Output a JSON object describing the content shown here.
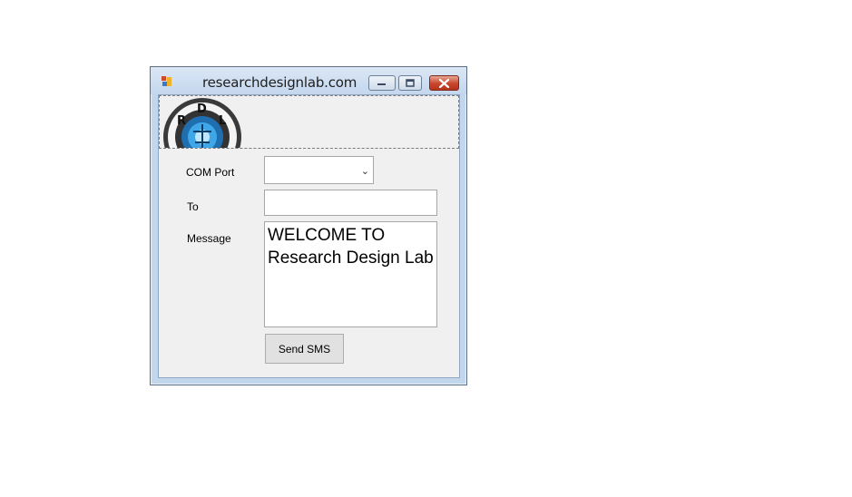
{
  "window": {
    "title": "researchdesignlab.com",
    "icon": "app-icon",
    "controls": [
      "minimize-icon",
      "maximize-icon",
      "close-icon"
    ]
  },
  "logo": {
    "letters": [
      "R",
      "D",
      "L"
    ]
  },
  "form": {
    "com_port_label": "COM Port",
    "com_port_value": "",
    "to_label": "To",
    "to_value": "",
    "message_label": "Message",
    "message_value": "WELCOME TO\nResearch Design Lab",
    "send_button_label": "Send SMS"
  },
  "colors": {
    "close_button": "#c8462c",
    "client_background": "#f0f0f0",
    "frame": "#c2d6ec"
  }
}
